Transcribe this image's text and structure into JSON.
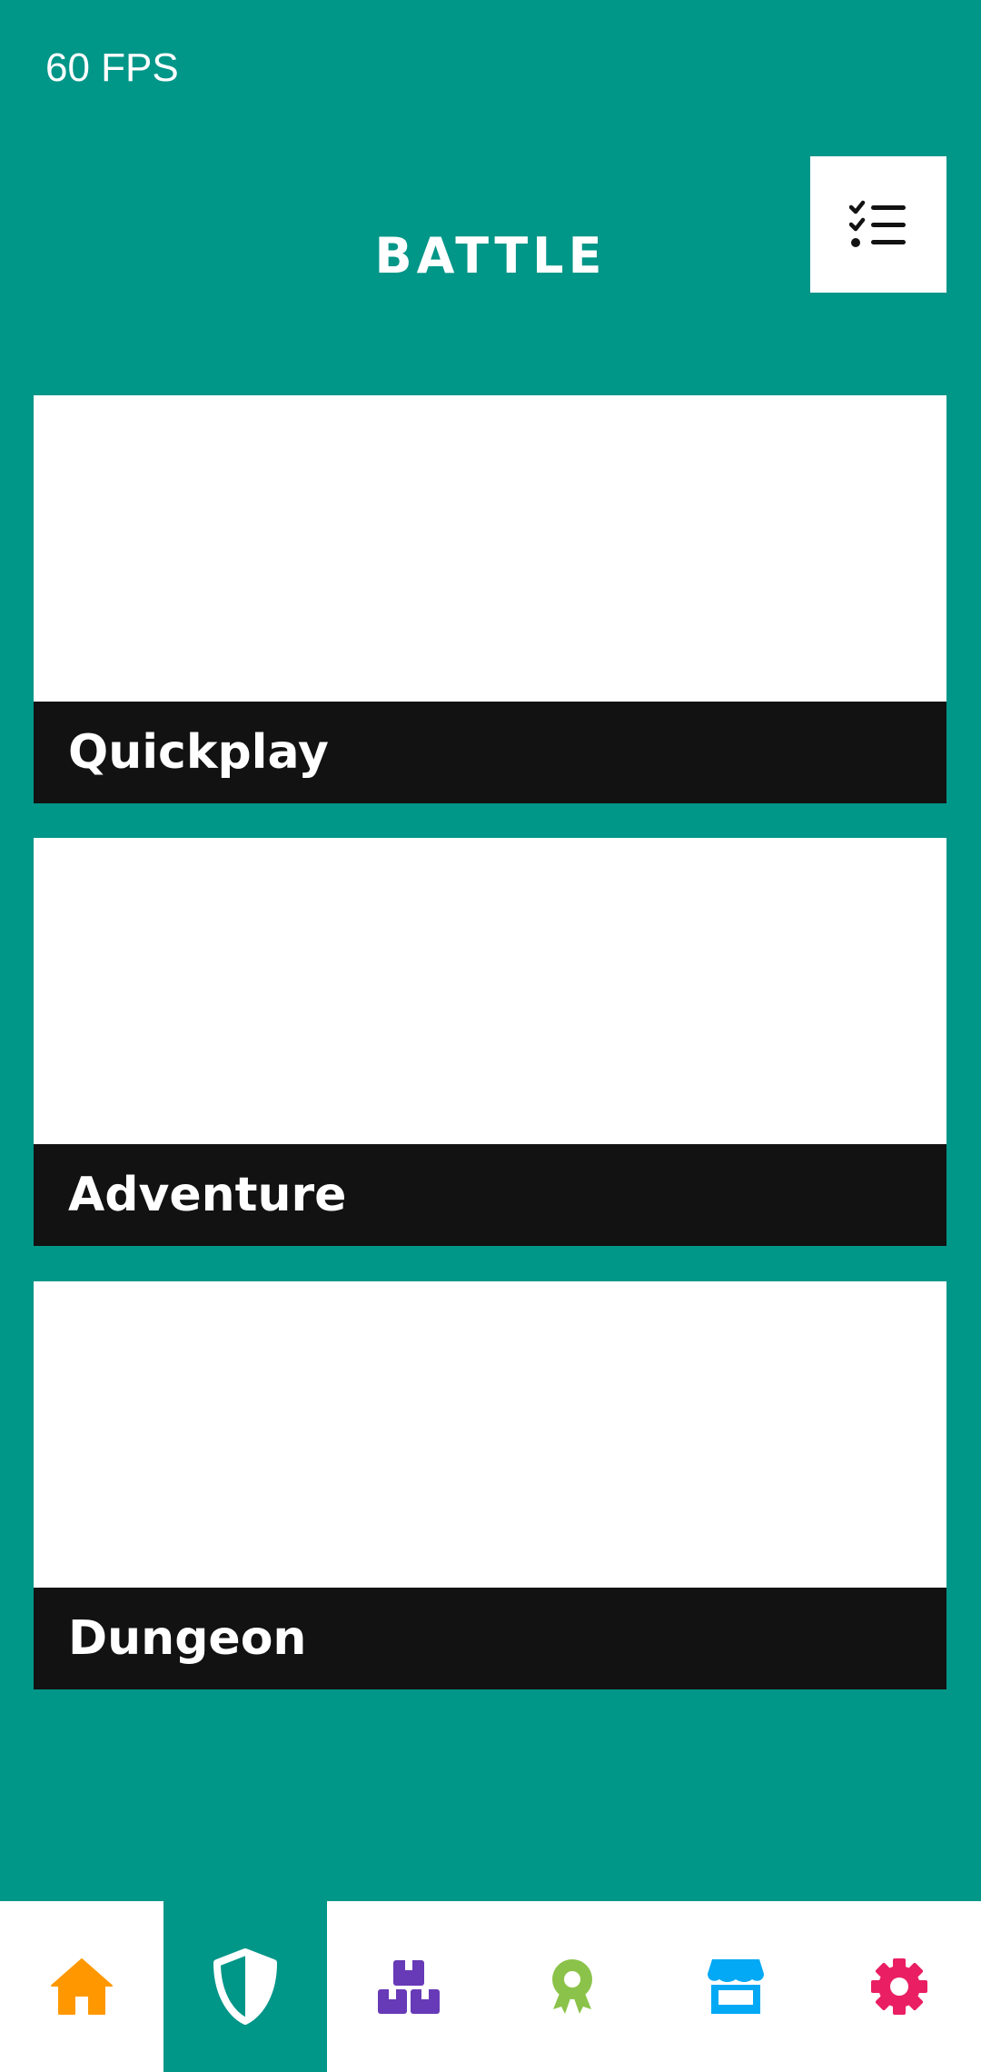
{
  "status": {
    "fps": "60 FPS"
  },
  "header": {
    "title": "BATTLE",
    "quest_button_icon": "checklist-icon"
  },
  "modes": [
    {
      "label": "Quickplay"
    },
    {
      "label": "Adventure"
    },
    {
      "label": "Dungeon"
    }
  ],
  "nav": {
    "active_index": 1,
    "items": [
      {
        "icon": "home-icon",
        "color": "#FF9800"
      },
      {
        "icon": "shield-icon",
        "color": "#FFFFFF"
      },
      {
        "icon": "boxes-icon",
        "color": "#673AB7"
      },
      {
        "icon": "award-icon",
        "color": "#8BC34A"
      },
      {
        "icon": "store-icon",
        "color": "#03A9F4"
      },
      {
        "icon": "gear-icon",
        "color": "#E91E63"
      }
    ]
  },
  "colors": {
    "background": "#009688",
    "card": "#FFFFFF",
    "label_bar": "#121212",
    "nav_bar": "#FFFFFF"
  }
}
